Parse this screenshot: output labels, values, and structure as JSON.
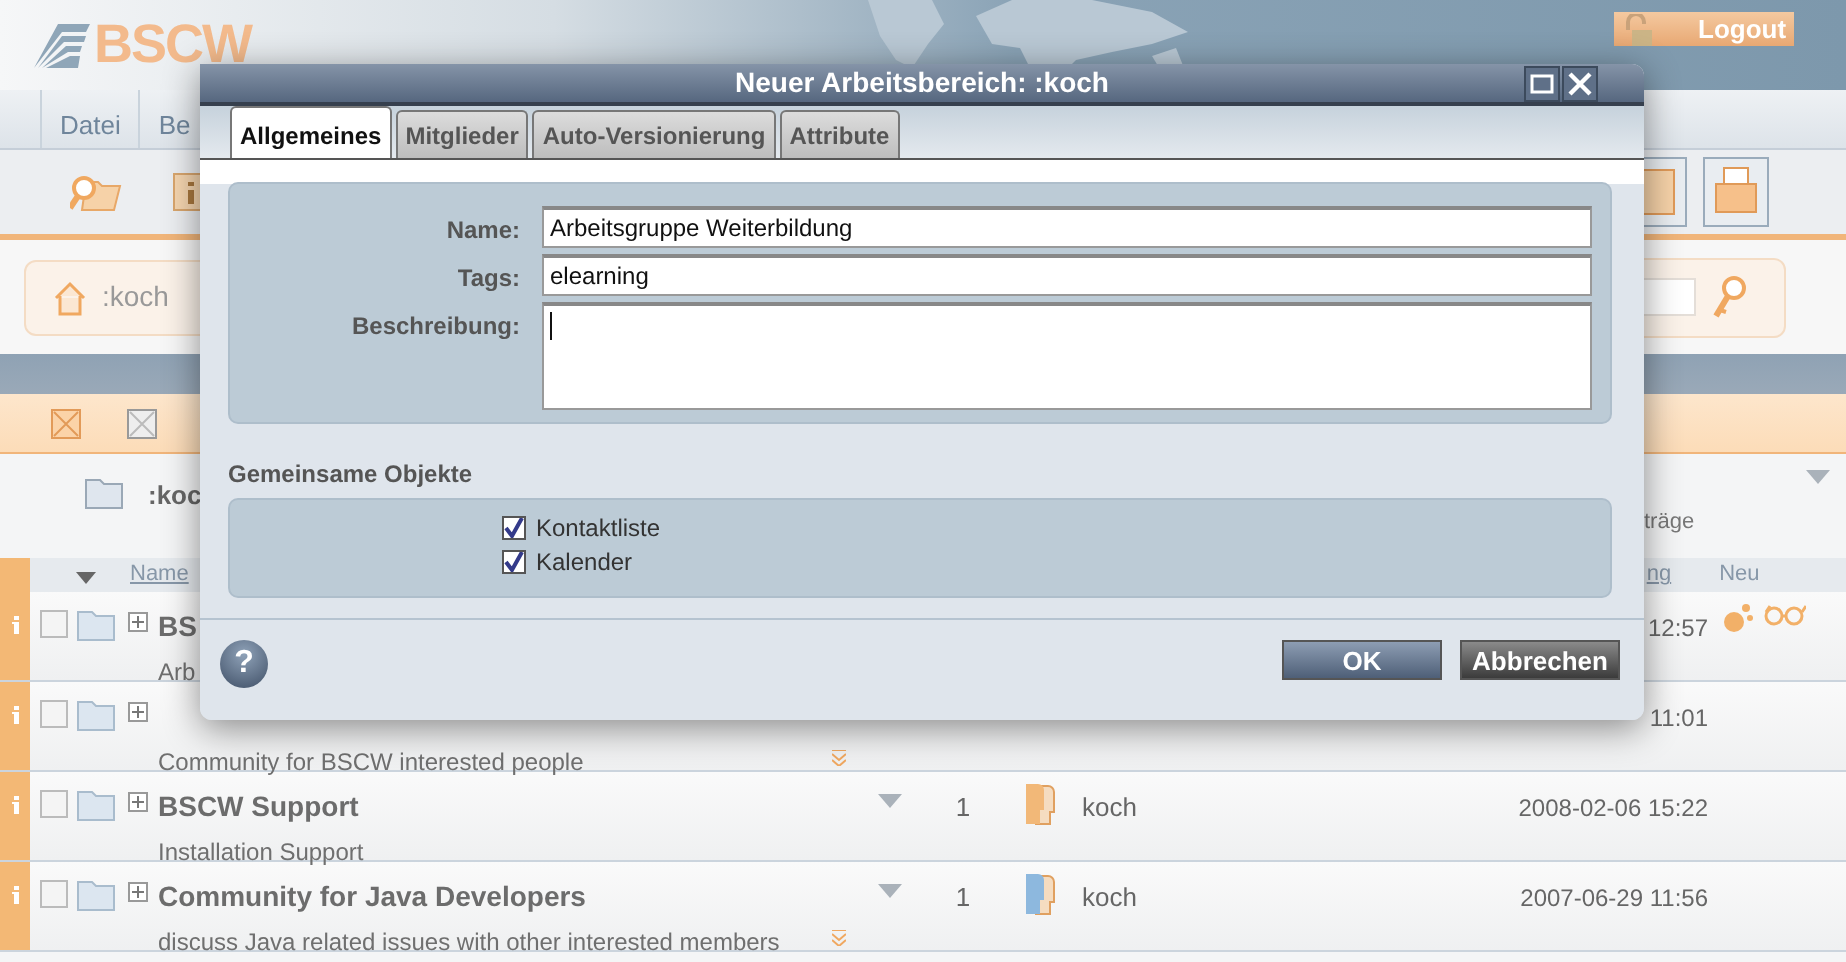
{
  "header": {
    "logo": "BSCW",
    "logout": "Logout"
  },
  "menu": [
    {
      "label": "Datei"
    },
    {
      "label": "Be"
    }
  ],
  "breadcrumb": ":koch",
  "folder": {
    "name": ":koc",
    "info": "träge"
  },
  "columns": [
    {
      "label": "Name"
    },
    {
      "label": "ng"
    },
    {
      "label": "Neu"
    }
  ],
  "rows": [
    {
      "name": "BS",
      "description": "Arb",
      "date": "12:57",
      "checked": false,
      "new": true,
      "expandable": false
    },
    {
      "description": "Community for BSCW interested people",
      "date": "11:01",
      "checked": false,
      "new": false,
      "expandable": true
    },
    {
      "name": "BSCW Support",
      "description": "Installation Support",
      "count": "1",
      "owner": "koch",
      "color": "#f2b878",
      "date": "2008-02-06 15:22",
      "checked": false,
      "new": false,
      "expandable": false
    },
    {
      "name": "Community for Java Developers",
      "description": "discuss Java related issues with other interested members",
      "count": "1",
      "owner": "koch",
      "color": "#8db8de",
      "date": "2007-06-29 11:56",
      "checked": false,
      "new": false,
      "expandable": true
    }
  ],
  "dialog": {
    "title": "Neuer Arbeitsbereich: :koch",
    "tabs": [
      {
        "label": "Allgemeines",
        "selected": true
      },
      {
        "label": "Mitglieder",
        "selected": false
      },
      {
        "label": "Auto-Versionierung",
        "selected": false
      },
      {
        "label": "Attribute",
        "selected": false
      }
    ],
    "fields": [
      {
        "label": "Name:",
        "value": "Arbeitsgruppe Weiterbildung",
        "kind": "input"
      },
      {
        "label": "Tags:",
        "value": "elearning",
        "kind": "input"
      },
      {
        "label": "Beschreibung:",
        "kind": "textarea"
      }
    ],
    "shared_heading": "Gemeinsame Objekte",
    "shared": [
      {
        "label": "Kontaktliste",
        "checked": true
      },
      {
        "label": "Kalender",
        "checked": true
      }
    ],
    "help": "?",
    "buttons": [
      {
        "label": "OK",
        "kind": "primary"
      },
      {
        "label": "Abbrechen",
        "kind": "secondary"
      }
    ]
  }
}
